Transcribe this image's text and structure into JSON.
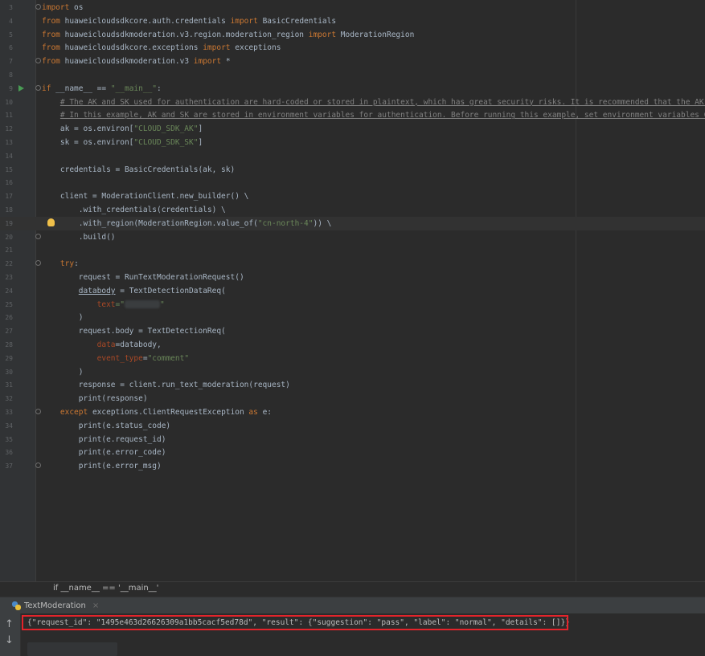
{
  "editor": {
    "lines": [
      {
        "n": "3",
        "code": [
          {
            "t": "import",
            "c": "kw"
          },
          {
            "t": " os"
          }
        ]
      },
      {
        "n": "4",
        "code": [
          {
            "t": "from",
            "c": "kw"
          },
          {
            "t": " huaweicloudsdkcore.auth.credentials "
          },
          {
            "t": "import",
            "c": "kw"
          },
          {
            "t": " BasicCredentials"
          }
        ]
      },
      {
        "n": "5",
        "code": [
          {
            "t": "from",
            "c": "kw"
          },
          {
            "t": " huaweicloudsdkmoderation.v3.region.moderation_region "
          },
          {
            "t": "import",
            "c": "kw"
          },
          {
            "t": " ModerationRegion"
          }
        ]
      },
      {
        "n": "6",
        "code": [
          {
            "t": "from",
            "c": "kw"
          },
          {
            "t": " huaweicloudsdkcore.exceptions "
          },
          {
            "t": "import",
            "c": "kw"
          },
          {
            "t": " exceptions"
          }
        ]
      },
      {
        "n": "7",
        "code": [
          {
            "t": "from",
            "c": "kw"
          },
          {
            "t": " huaweicloudsdkmoderation.v3 "
          },
          {
            "t": "import",
            "c": "kw"
          },
          {
            "t": " *"
          }
        ]
      },
      {
        "n": "8",
        "code": []
      },
      {
        "n": "9",
        "code": [
          {
            "t": "if",
            "c": "kw"
          },
          {
            "t": " __name__ == "
          },
          {
            "t": "\"__main__\"",
            "c": "str"
          },
          {
            "t": ":"
          }
        ]
      },
      {
        "n": "10",
        "code": [
          {
            "t": "    "
          },
          {
            "t": "# The AK and SK used for authentication are hard-coded or stored in plaintext, which has great security risks. It is recommended that the AK and",
            "c": "cm"
          }
        ]
      },
      {
        "n": "11",
        "code": [
          {
            "t": "    "
          },
          {
            "t": "# In this example, AK and SK are stored in environment variables for authentication. Before running this example, set environment variables CLOUD",
            "c": "cm"
          }
        ]
      },
      {
        "n": "12",
        "code": [
          {
            "t": "    ak = os.environ["
          },
          {
            "t": "\"CLOUD_SDK_AK\"",
            "c": "str"
          },
          {
            "t": "]"
          }
        ]
      },
      {
        "n": "13",
        "code": [
          {
            "t": "    sk = os.environ["
          },
          {
            "t": "\"CLOUD_SDK_SK\"",
            "c": "str"
          },
          {
            "t": "]"
          }
        ]
      },
      {
        "n": "14",
        "code": []
      },
      {
        "n": "15",
        "code": [
          {
            "t": "    credentials = BasicCredentials(ak, sk)"
          }
        ]
      },
      {
        "n": "16",
        "code": []
      },
      {
        "n": "17",
        "code": [
          {
            "t": "    client = ModerationClient.new_builder() \\"
          }
        ]
      },
      {
        "n": "18",
        "code": [
          {
            "t": "        .with_credentials(credentials) \\"
          }
        ]
      },
      {
        "n": "19",
        "code": [
          {
            "t": "        .with_region(ModerationRegion.value_of("
          },
          {
            "t": "\"cn-north-4\"",
            "c": "str"
          },
          {
            "t": ")) \\"
          }
        ]
      },
      {
        "n": "20",
        "code": [
          {
            "t": "        .build()"
          }
        ]
      },
      {
        "n": "21",
        "code": []
      },
      {
        "n": "22",
        "code": [
          {
            "t": "    "
          },
          {
            "t": "try",
            "c": "kw"
          },
          {
            "t": ":"
          }
        ]
      },
      {
        "n": "23",
        "code": [
          {
            "t": "        request = RunTextModerationRequest()"
          }
        ]
      },
      {
        "n": "24",
        "code": [
          {
            "t": "        "
          },
          {
            "t": "databody",
            "c": "ul"
          },
          {
            "t": " = TextDetectionDataReq("
          }
        ]
      },
      {
        "n": "25",
        "code": [
          {
            "t": "            "
          },
          {
            "t": "text",
            "c": "kwarg"
          },
          {
            "t": "=\"",
            "c": "str"
          },
          {
            "blur": true
          },
          {
            "t": "\"",
            "c": "str"
          }
        ]
      },
      {
        "n": "26",
        "code": [
          {
            "t": "        )"
          }
        ]
      },
      {
        "n": "27",
        "code": [
          {
            "t": "        request.body = TextDetectionReq("
          }
        ]
      },
      {
        "n": "28",
        "code": [
          {
            "t": "            "
          },
          {
            "t": "data",
            "c": "kwarg"
          },
          {
            "t": "=databody,"
          }
        ]
      },
      {
        "n": "29",
        "code": [
          {
            "t": "            "
          },
          {
            "t": "event_type",
            "c": "kwarg"
          },
          {
            "t": "="
          },
          {
            "t": "\"comment\"",
            "c": "str"
          }
        ]
      },
      {
        "n": "30",
        "code": [
          {
            "t": "        )"
          }
        ]
      },
      {
        "n": "31",
        "code": [
          {
            "t": "        response = client.run_text_moderation(request)"
          }
        ]
      },
      {
        "n": "32",
        "code": [
          {
            "t": "        print(response)"
          }
        ]
      },
      {
        "n": "33",
        "code": [
          {
            "t": "    "
          },
          {
            "t": "except",
            "c": "kw"
          },
          {
            "t": " exceptions.ClientRequestException "
          },
          {
            "t": "as",
            "c": "kw"
          },
          {
            "t": " e:"
          }
        ]
      },
      {
        "n": "34",
        "code": [
          {
            "t": "        print(e.status_code)"
          }
        ]
      },
      {
        "n": "35",
        "code": [
          {
            "t": "        print(e.request_id)"
          }
        ]
      },
      {
        "n": "36",
        "code": [
          {
            "t": "        print(e.error_code)"
          }
        ]
      },
      {
        "n": "37",
        "code": [
          {
            "t": "        print(e.error_msg)"
          }
        ]
      }
    ]
  },
  "breadcrumb": {
    "text": "if __name__ == '__main__'"
  },
  "run_panel": {
    "tab_label": "TextModeration",
    "close_glyph": "×",
    "up_arrow": "↑",
    "down_arrow": "↓",
    "output": "{\"request_id\": \"1495e463d26626309a1bb5cacf5ed78d\", \"result\": {\"suggestion\": \"pass\", \"label\": \"normal\", \"details\": []}}"
  },
  "colors": {
    "keyword": "#cc7832",
    "string": "#6a8759",
    "comment": "#808080",
    "highlight_box": "#e3242b"
  }
}
